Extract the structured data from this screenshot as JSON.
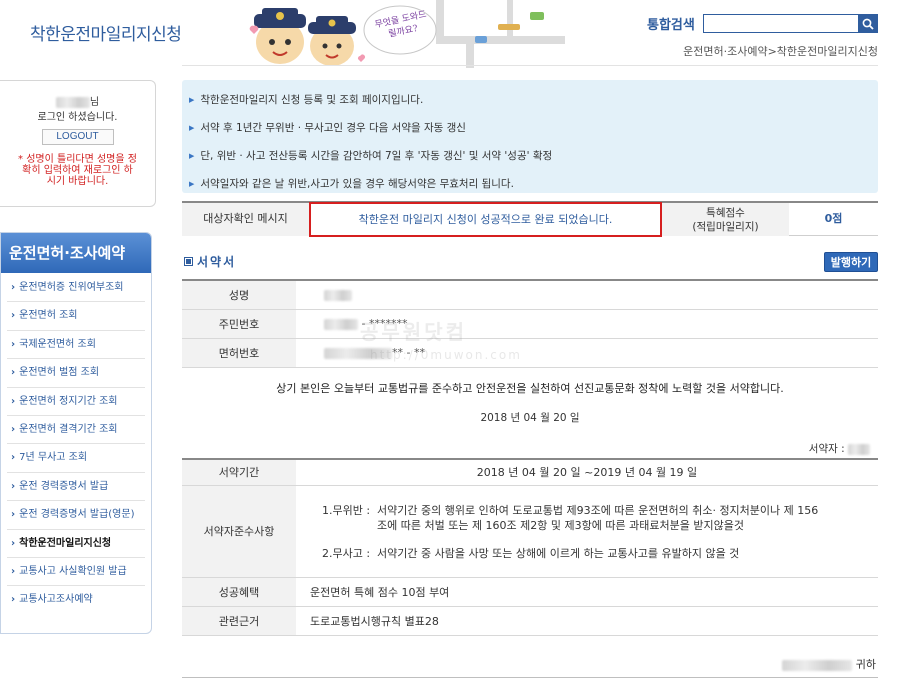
{
  "header": {
    "site_title": "착한운전마일리지신청",
    "banner_caption": "무엇을 도와드릴까요?",
    "search_label": "통합검색",
    "search_value": "",
    "breadcrumb": "운전면허·조사예약>착한운전마일리지신청"
  },
  "login": {
    "name_suffix": "님",
    "greeting": "로그인 하셨습니다.",
    "logout_label": "LOGOUT",
    "warning": "* 성명이 틀리다면 성명을 정확히 입력하여 재로그인 하시기 바랍니다."
  },
  "menu": {
    "title": "운전면허·조사예약",
    "items": [
      {
        "label": "운전면허증 진위여부조회"
      },
      {
        "label": "운전면허 조회"
      },
      {
        "label": "국제운전면허 조회"
      },
      {
        "label": "운전면허 벌점 조회"
      },
      {
        "label": "운전면허 정지기간 조회"
      },
      {
        "label": "운전면허 결격기간 조회"
      },
      {
        "label": "7년 무사고 조회"
      },
      {
        "label": "운전 경력증명서 발급"
      },
      {
        "label": "운전 경력증명서 발급(영문)"
      },
      {
        "label": "착한운전마일리지신청",
        "active": true
      },
      {
        "label": "교통사고 사실확인원 발급"
      },
      {
        "label": "교통사고조사예약"
      }
    ]
  },
  "info": [
    "착한운전마일리지 신청 등록 및 조회 페이지입니다.",
    "서약 후 1년간 무위반 · 무사고인 경우 다음 서약을 자동 갱신",
    "단, 위반 · 사고 전산등록 시간을 감안하여 7일 후 '자동 갱신' 및 서약 '성공' 확정",
    "서약일자와 같은 날 위반,사고가 있을 경우 해당서약은 무효처리 됩니다."
  ],
  "confirm": {
    "label": "대상자확인 메시지",
    "message": "착한운전 마일리지 신청이 성공적으로 완료 되었습니다.",
    "points_label_1": "특혜점수",
    "points_label_2": "(적립마일리지)",
    "points_value": "0점"
  },
  "pledge": {
    "heading": "서약서",
    "issue_button": "발행하기",
    "fields": {
      "name_label": "성명",
      "rrn_label": "주민번호",
      "rrn_masked": "- *******",
      "license_label": "면허번호",
      "license_masked": "** - **"
    },
    "statement": "상기 본인은 오늘부터 교통법규를 준수하고 안전운전을 실천하여 선진교통문화 정착에 노력할 것을 서약합니다.",
    "date": "2018 년 04 월 20 일",
    "pledger_label": "서약자 :"
  },
  "terms": {
    "period_label": "서약기간",
    "period_value": "2018 년 04 월 20 일 ~2019 년 04 월 19 일",
    "compliance_label": "서약자준수사항",
    "clause1_head": "1.무위반 :",
    "clause1_line1": "서약기간 중의 행위로 인하여 도로교통법 제93조에 따른 운전면허의 취소· 정지처분이나 제 156",
    "clause1_line2": "조에 따른 처벌 또는 제 160조 제2항 및 제3항에 따른 과태료처분을 받지않을것",
    "clause2_head": "2.무사고 :",
    "clause2_body": "서약기간 중 사람을 사망 또는 상해에 이르게 하는 교통사고를 유발하지 않을 것",
    "benefit_label": "성공혜택",
    "benefit_value": "운전면허 특혜 점수 10점 부여",
    "basis_label": "관련근거",
    "basis_value": "도로교통법시행규칙 별표28"
  },
  "watermark": {
    "text": "공무원닷컴",
    "url": "http://0muwon.com"
  },
  "footer": {
    "to_suffix": "귀하"
  },
  "colors": {
    "brand_blue": "#2f5d9e",
    "info_bg": "#e3f1f9",
    "highlight_red": "#d61f1f",
    "menu_header": "#2f69b8"
  }
}
